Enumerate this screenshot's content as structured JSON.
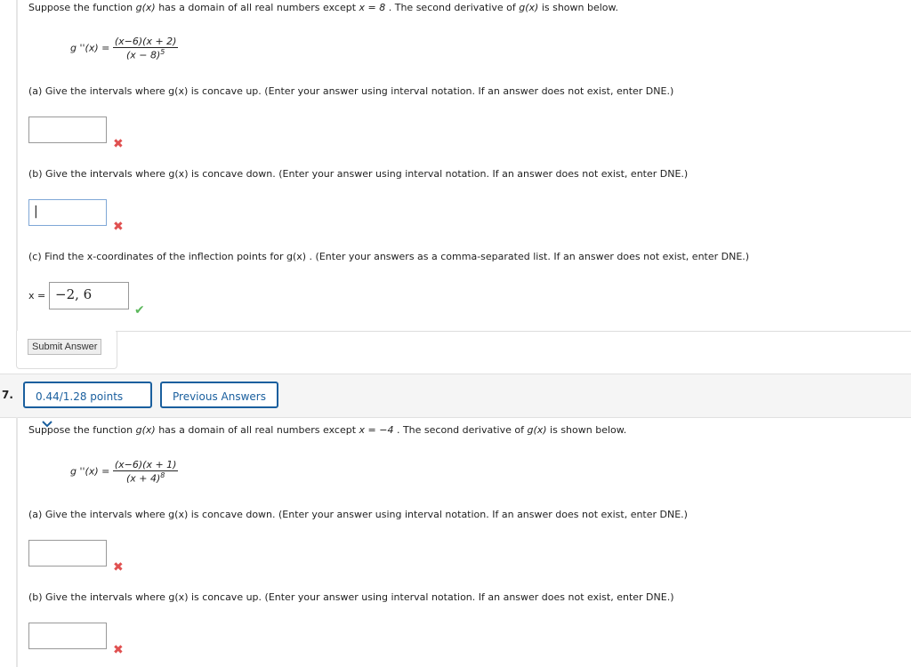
{
  "q6": {
    "intro_pre": "Suppose the function ",
    "intro_fn": "g(x)",
    "intro_mid": " has a domain of all real numbers except ",
    "intro_x": "x = 8",
    "intro_post": " . The second derivative of ",
    "intro_fn2": "g(x)",
    "intro_end": " is shown below.",
    "deriv_lhs": "g ''(x) =",
    "deriv_num": "(x−6)(x + 2)",
    "deriv_den": "(x − 8)",
    "deriv_exp": "5",
    "part_a": "(a) Give the intervals where  g(x)  is concave up. (Enter your answer using interval notation. If an answer does not exist, enter DNE.)",
    "part_a_value": "",
    "part_a_status": "incorrect",
    "part_b": "(b) Give the intervals where  g(x)  is concave down. (Enter your answer using interval notation. If an answer does not exist, enter DNE.)",
    "part_b_value": "|",
    "part_b_status": "incorrect",
    "part_c": "(c) Find the x-coordinates of the inflection points for  g(x) . (Enter your answers as a comma-separated list. If an answer does not exist, enter DNE.)",
    "part_c_label": "x =",
    "part_c_value": "−2, 6",
    "part_c_status": "correct",
    "submit_label": "Submit Answer"
  },
  "q7": {
    "number": "7.",
    "points_label": "0.44/1.28 points",
    "previous_answers_label": "Previous Answers",
    "intro_pre": "Suppose the function ",
    "intro_fn": "g(x)",
    "intro_mid": " has a domain of all real numbers except ",
    "intro_x": "x = −4",
    "intro_post": " . The second derivative of ",
    "intro_fn2": "g(x)",
    "intro_end": " is shown below.",
    "deriv_lhs": "g ''(x) =",
    "deriv_num": "(x−6)(x + 1)",
    "deriv_den": "(x + 4)",
    "deriv_exp": "8",
    "part_a": "(a) Give the intervals where  g(x)  is concave down. (Enter your answer using interval notation. If an answer does not exist, enter DNE.)",
    "part_a_value": "",
    "part_a_status": "incorrect",
    "part_b": "(b) Give the intervals where  g(x)  is concave up. (Enter your answer using interval notation. If an answer does not exist, enter DNE.)",
    "part_b_value": "",
    "part_b_status": "incorrect"
  },
  "icons": {
    "incorrect": "✖",
    "correct": "✔",
    "chevron": "⌄"
  },
  "colors": {
    "accent": "#1a5f9e",
    "incorrect": "#e05050",
    "correct": "#5cb85c"
  }
}
